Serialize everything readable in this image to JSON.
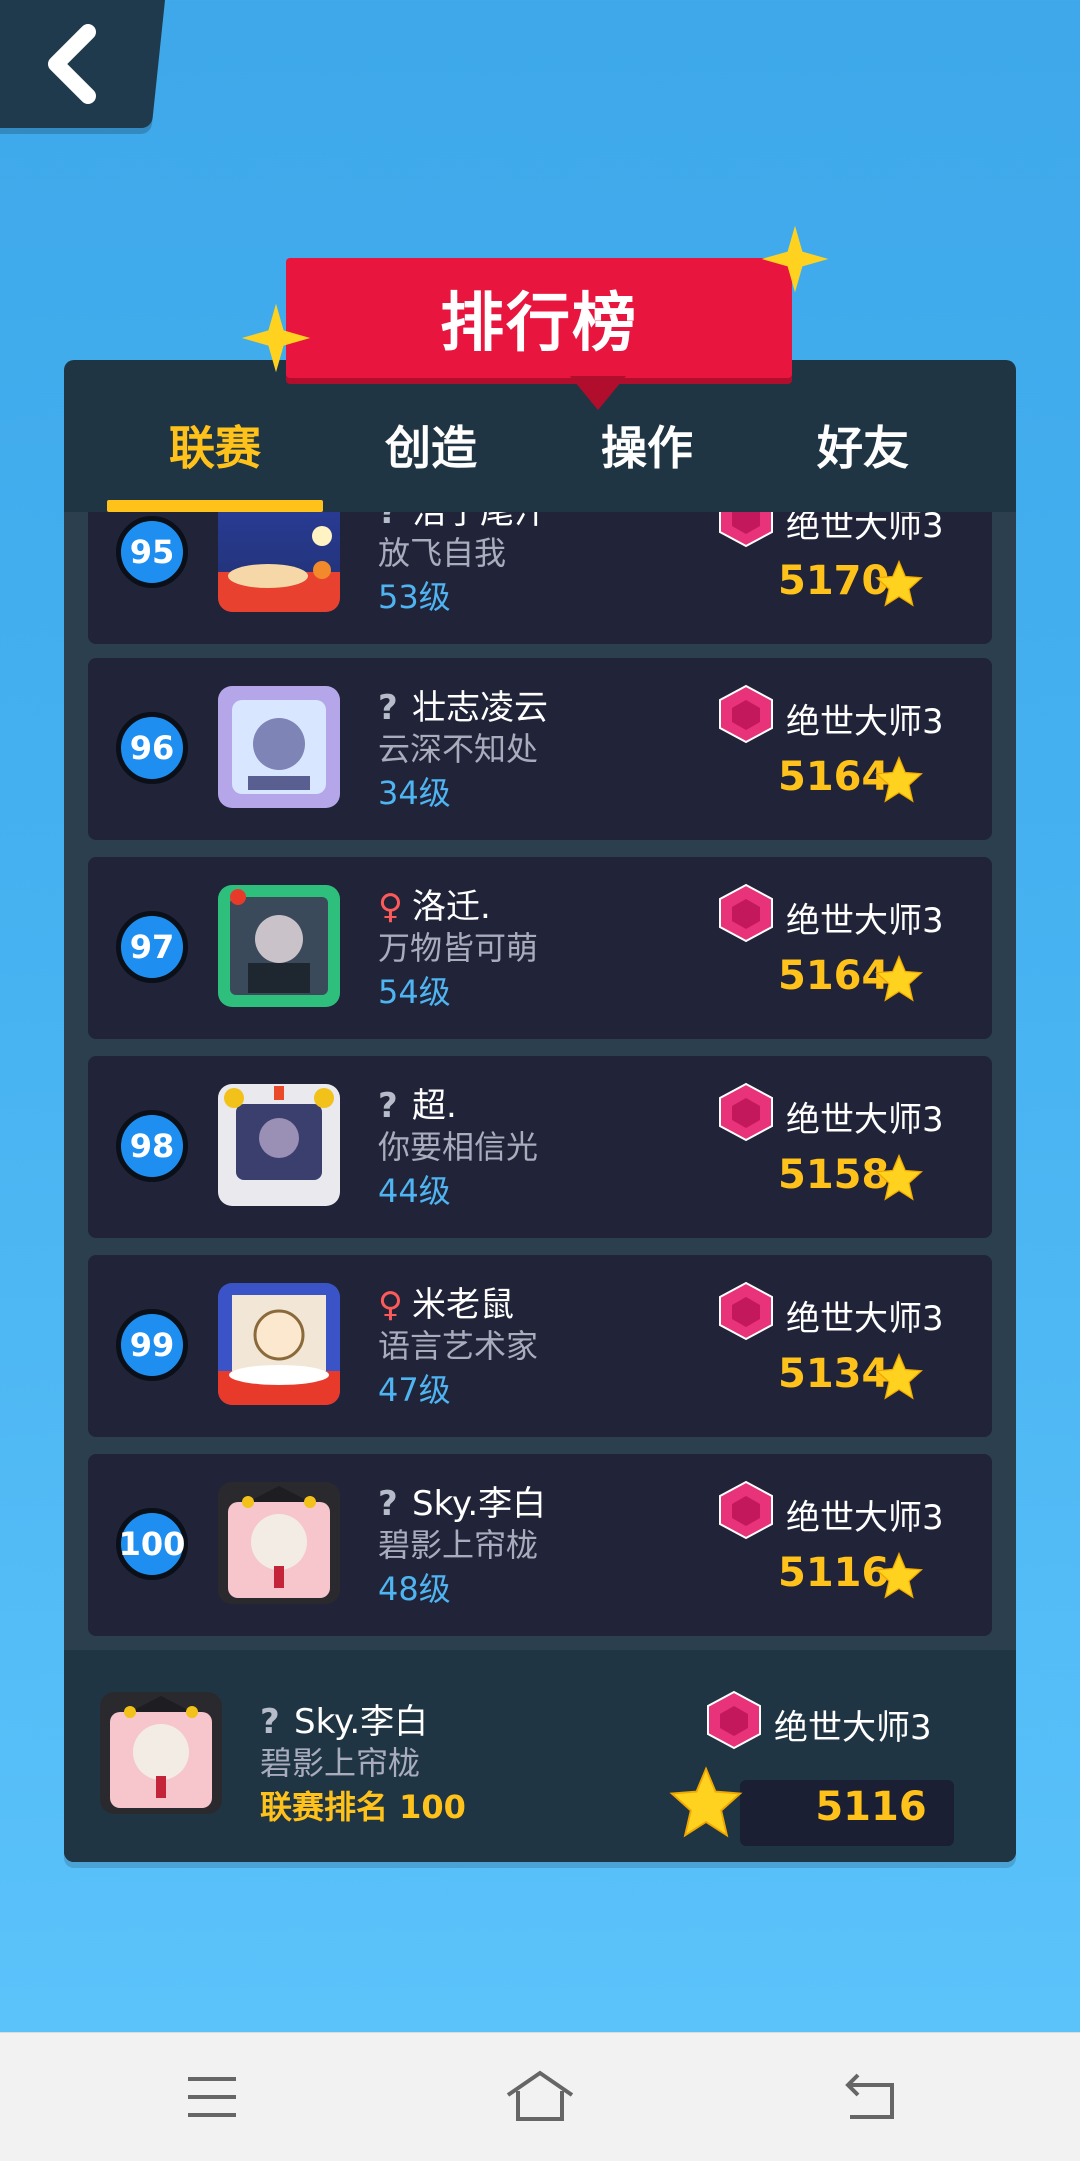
{
  "header": {
    "title": "排行榜"
  },
  "tabs": [
    {
      "label": "联赛",
      "active": true
    },
    {
      "label": "创造",
      "active": false
    },
    {
      "label": "操作",
      "active": false
    },
    {
      "label": "好友",
      "active": false
    }
  ],
  "rows": [
    {
      "rank": "95",
      "gender": "?",
      "name": "浩子尾汁",
      "signature": "放飞自我",
      "level": "53级",
      "tier": "绝世大师3",
      "score": "5170"
    },
    {
      "rank": "96",
      "gender": "?",
      "name": "壮志凌云",
      "signature": "云深不知处",
      "level": "34级",
      "tier": "绝世大师3",
      "score": "5164"
    },
    {
      "rank": "97",
      "gender": "♀",
      "name": "洛迁.",
      "signature": "万物皆可萌",
      "level": "54级",
      "tier": "绝世大师3",
      "score": "5164"
    },
    {
      "rank": "98",
      "gender": "?",
      "name": "超.",
      "signature": "你要相信光",
      "level": "44级",
      "tier": "绝世大师3",
      "score": "5158"
    },
    {
      "rank": "99",
      "gender": "♀",
      "name": "米老鼠",
      "signature": "语言艺术家",
      "level": "47级",
      "tier": "绝世大师3",
      "score": "5134"
    },
    {
      "rank": "100",
      "gender": "?",
      "name": "Sky.李白",
      "signature": "碧影上帘栊",
      "level": "48级",
      "tier": "绝世大师3",
      "score": "5116"
    }
  ],
  "me": {
    "gender": "?",
    "name": "Sky.李白",
    "signature": "碧影上帘栊",
    "rank_label": "联赛排名 100",
    "tier": "绝世大师3",
    "score": "5116"
  },
  "colors": {
    "accent": "#ffc21a",
    "ribbon": "#e8163e",
    "panel": "#203544",
    "row": "#212438",
    "level": "#4fb4f2"
  },
  "icons": {
    "back": "chevron-left-icon",
    "gem": "pink-gem-icon",
    "star": "star-icon",
    "menu": "menu-icon",
    "home": "home-icon",
    "return": "return-icon"
  }
}
